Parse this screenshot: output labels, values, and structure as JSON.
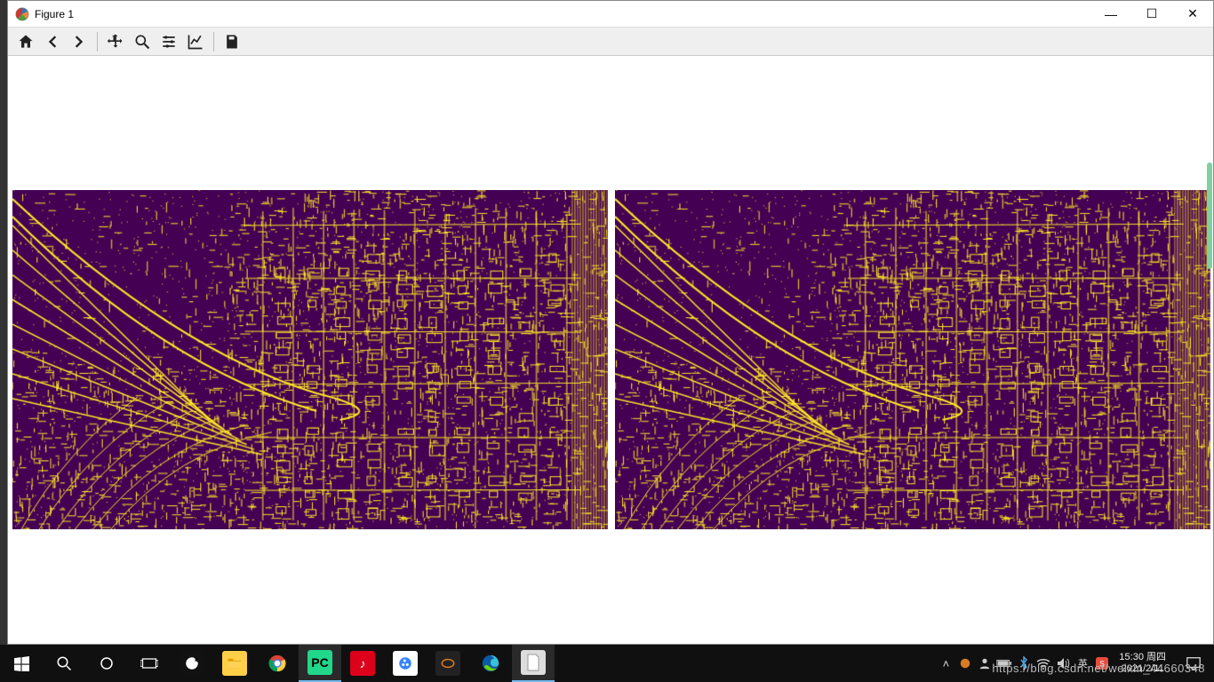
{
  "window": {
    "title": "Figure 1"
  },
  "toolbar": {
    "home": "Home",
    "back": "Back",
    "forward": "Forward",
    "pan": "Pan",
    "zoom": "Zoom",
    "configure": "Configure subplots",
    "edit": "Edit axis",
    "save": "Save"
  },
  "win_controls": {
    "minimize": "—",
    "maximize": "☐",
    "close": "✕"
  },
  "plot": {
    "colors": {
      "bg": "#440154",
      "fg": "#fde725"
    },
    "subplots": 2
  },
  "taskbar": {
    "clock_time": "15:30",
    "clock_day": "周四",
    "clock_date": "2021/2/11",
    "watermark": "https://blog.csdn.net/weixin_44660348"
  }
}
